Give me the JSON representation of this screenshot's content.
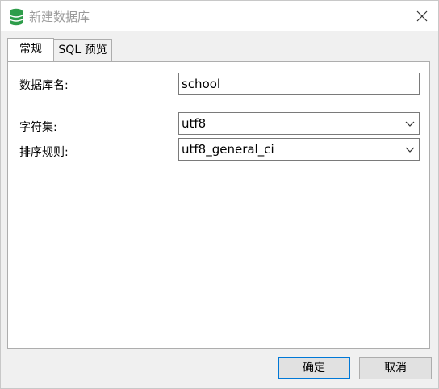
{
  "window": {
    "title": "新建数据库"
  },
  "tabs": [
    {
      "label": "常规",
      "active": true
    },
    {
      "label": "SQL 预览",
      "active": false
    }
  ],
  "form": {
    "db_name_label": "数据库名:",
    "db_name_value": "school",
    "charset_label": "字符集:",
    "charset_value": "utf8",
    "collation_label": "排序规则:",
    "collation_value": "utf8_general_ci"
  },
  "buttons": {
    "ok_label": "确定",
    "cancel_label": "取消"
  },
  "colors": {
    "accent": "#0078d7",
    "icon_green": "#2e9d4a"
  }
}
